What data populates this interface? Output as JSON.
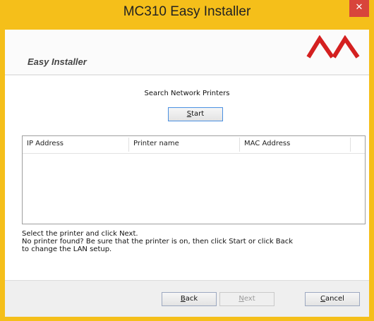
{
  "window": {
    "title": "MC310 Easy Installer",
    "close_glyph": "✕"
  },
  "header": {
    "title": "Easy Installer",
    "logo_icon": "oki-logo-icon",
    "logo_color": "#d42020"
  },
  "search": {
    "label": "Search Network Printers",
    "start_button": {
      "accel": "S",
      "rest": "tart"
    }
  },
  "table": {
    "columns": [
      "IP Address",
      "Printer name",
      "MAC Address"
    ],
    "rows": []
  },
  "message": {
    "lines": [
      "Select the printer and click Next.",
      "No printer found? Be sure that the printer is on, then click Start or click Back",
      "to change the LAN setup."
    ]
  },
  "footer": {
    "back": {
      "accel": "B",
      "rest": "ack"
    },
    "next": {
      "accel": "N",
      "rest": "ext",
      "disabled": true
    },
    "cancel": {
      "accel": "C",
      "rest": "ancel"
    }
  },
  "colors": {
    "frame": "#f5bf1a",
    "close": "#d8453b"
  }
}
